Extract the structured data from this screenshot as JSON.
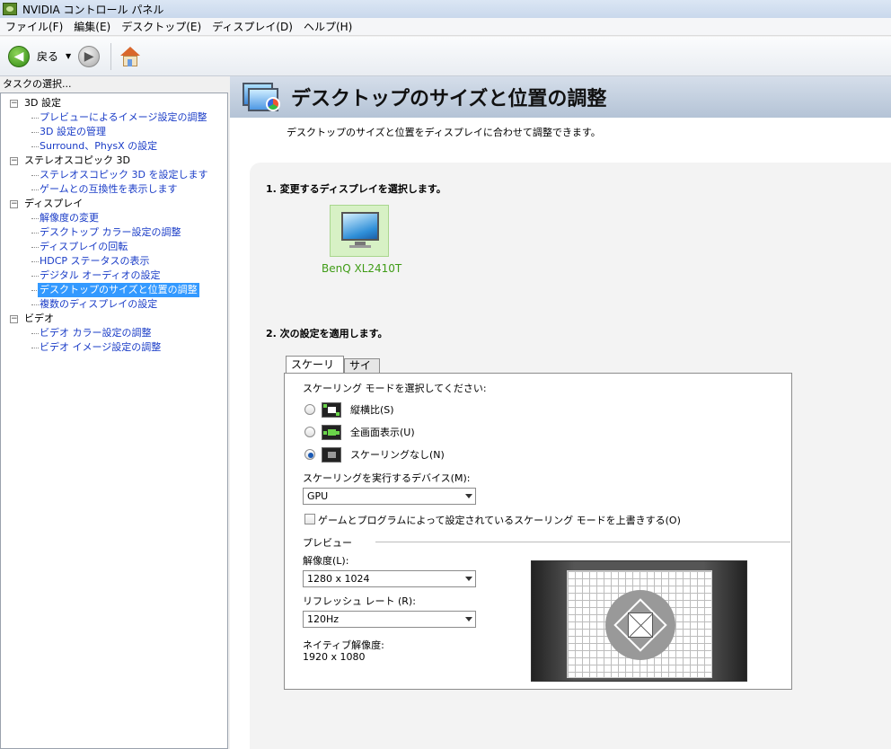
{
  "window": {
    "title": "NVIDIA コントロール パネル"
  },
  "menu": [
    "ファイル(F)",
    "編集(E)",
    "デスクトップ(E)",
    "ディスプレイ(D)",
    "ヘルプ(H)"
  ],
  "toolbar": {
    "back_label": "戻る"
  },
  "sidebar": {
    "header": "タスクの選択...",
    "categories": [
      {
        "label": "3D 設定",
        "items": [
          "プレビューによるイメージ設定の調整",
          "3D 設定の管理",
          "Surround、PhysX の設定"
        ]
      },
      {
        "label": "ステレオスコピック 3D",
        "items": [
          "ステレオスコピック 3D を設定します",
          "ゲームとの互換性を表示します"
        ]
      },
      {
        "label": "ディスプレイ",
        "items": [
          "解像度の変更",
          "デスクトップ カラー設定の調整",
          "ディスプレイの回転",
          "HDCP ステータスの表示",
          "デジタル オーディオの設定",
          "デスクトップのサイズと位置の調整",
          "複数のディスプレイの設定"
        ]
      },
      {
        "label": "ビデオ",
        "items": [
          "ビデオ カラー設定の調整",
          "ビデオ イメージ設定の調整"
        ]
      }
    ]
  },
  "page": {
    "title": "デスクトップのサイズと位置の調整",
    "description": "デスクトップのサイズと位置をディスプレイに合わせて調整できます。",
    "section1": "1. 変更するディスプレイを選択します。",
    "display_name": "BenQ XL2410T",
    "section2": "2. 次の設定を適用します。",
    "tabs": [
      "スケーリング",
      "サイズ"
    ],
    "scaling_prompt": "スケーリング モードを選択してください:",
    "modes": [
      "縦横比(S)",
      "全画面表示(U)",
      "スケーリングなし(N)"
    ],
    "device_label": "スケーリングを実行するデバイス(M):",
    "device_value": "GPU",
    "override_label": "ゲームとプログラムによって設定されているスケーリング モードを上書きする(O)",
    "preview_label": "プレビュー",
    "resolution_label": "解像度(L):",
    "resolution_value": "1280 x 1024",
    "refresh_label": "リフレッシュ レート (R):",
    "refresh_value": "120Hz",
    "native_label": "ネイティブ解像度:",
    "native_value": "1920 x 1080"
  }
}
